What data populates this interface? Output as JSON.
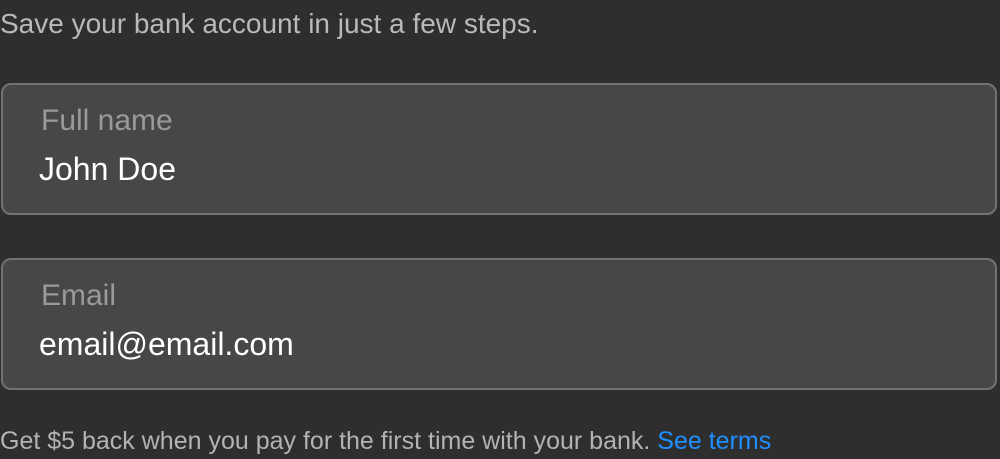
{
  "intro": {
    "text": "Save your bank account in just a few steps."
  },
  "form": {
    "full_name": {
      "label": "Full name",
      "value": "John Doe"
    },
    "email": {
      "label": "Email",
      "value": "email@email.com"
    }
  },
  "promo": {
    "text": "Get $5 back when you pay for the first time with your bank.",
    "link_label": "See terms"
  },
  "colors": {
    "background": "#2e2e2e",
    "field_background": "#474747",
    "field_border": "#727272",
    "link": "#1f8fff"
  }
}
